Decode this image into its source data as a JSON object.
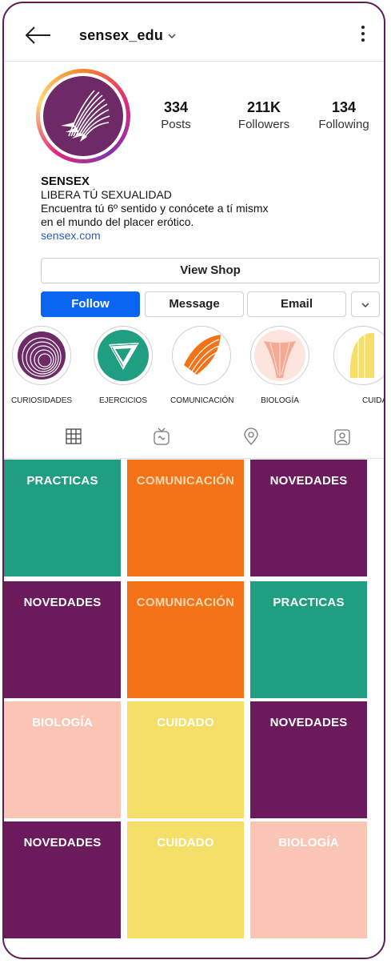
{
  "header": {
    "username": "sensex_edu"
  },
  "stats": [
    {
      "value": "334",
      "label": "Posts"
    },
    {
      "value": "211K",
      "label": "Followers"
    },
    {
      "value": "134",
      "label": "Following"
    }
  ],
  "bio": {
    "name": "SENSEX",
    "line1": "LIBERA TÚ SEXUALIDAD",
    "line2": "Encuentra tú 6º sentido y conócete a tí mismx",
    "line3": "en el mundo del placer erótico.",
    "link": "sensex.com"
  },
  "buttons": {
    "view_shop": "View Shop",
    "follow": "Follow",
    "message": "Message",
    "email": "Email"
  },
  "highlights": [
    {
      "label": "CURIOSIDADES"
    },
    {
      "label": "EJERCICIOS"
    },
    {
      "label": "COMUNICACIÓN"
    },
    {
      "label": "BIOLOGÍA"
    },
    {
      "label": "CUIDA"
    }
  ],
  "tabs": [
    "grid-icon",
    "igtv-icon",
    "location-icon",
    "tagged-icon"
  ],
  "posts": [
    {
      "label": "PRACTICAS",
      "color": "#1f9e82",
      "text_color": "#ffffff"
    },
    {
      "label": "COMUNICACIÓN",
      "color": "#f57318",
      "text_color": "#ffd9b0"
    },
    {
      "label": "NOVEDADES",
      "color": "#6b1b5c",
      "text_color": "#ffffff"
    },
    {
      "label": "NOVEDADES",
      "color": "#6b1b5c",
      "text_color": "#ffffff"
    },
    {
      "label": "COMUNICACIÓN",
      "color": "#f57318",
      "text_color": "#ffd9b0"
    },
    {
      "label": "PRACTICAS",
      "color": "#1f9e82",
      "text_color": "#ffffff"
    },
    {
      "label": "BIOLOGÍA",
      "color": "#fbc5b5",
      "text_color": "#ffffff"
    },
    {
      "label": "CUIDADO",
      "color": "#f5df68",
      "text_color": "#ffffff"
    },
    {
      "label": "NOVEDADES",
      "color": "#6b1b5c",
      "text_color": "#ffffff"
    },
    {
      "label": "NOVEDADES",
      "color": "#6b1b5c",
      "text_color": "#ffffff"
    },
    {
      "label": "CUIDADO",
      "color": "#f5df68",
      "text_color": "#ffffff"
    },
    {
      "label": "BIOLOGÍA",
      "color": "#fbc5b5",
      "text_color": "#ffffff"
    }
  ],
  "colors": {
    "accent": "#0a65f0",
    "brand": "#6d2a66",
    "link": "#2a5bb8"
  }
}
